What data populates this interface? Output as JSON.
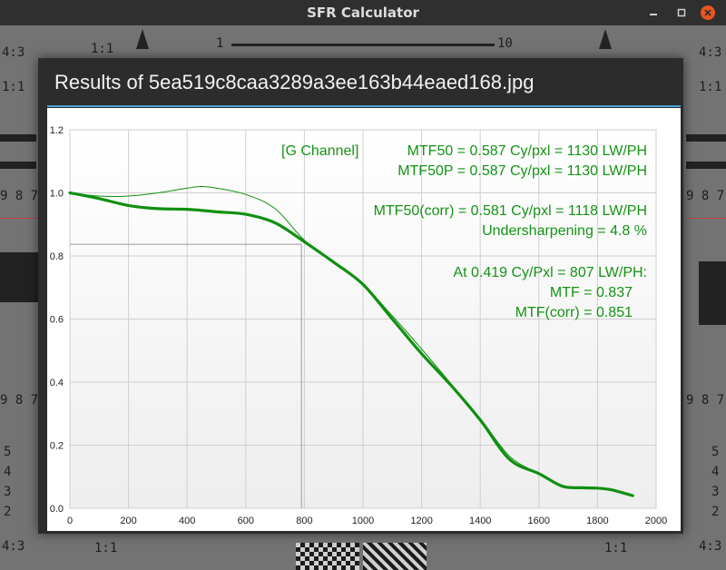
{
  "window": {
    "title": "SFR Calculator"
  },
  "dialog": {
    "title": "Results of 5ea519c8caa3289a3ee163b44eaed168.jpg"
  },
  "background_chart": {
    "top_ruler_start": "1",
    "top_ruler_end": "10",
    "left_labels": [
      "4:3",
      "1:1",
      "9 8 7",
      "9 8 7",
      "5",
      "4",
      "3",
      "2",
      "4:3"
    ],
    "right_labels": [
      "4:3",
      "1:1",
      "9 8 7",
      "9 8 7",
      "5",
      "4",
      "3",
      "2",
      "4:3"
    ],
    "bottom_labels": [
      "1:1",
      "1:1"
    ]
  },
  "annotations": {
    "channel": "[G Channel]",
    "mtf50": "MTF50 = 0.587 Cy/pxl = 1130 LW/PH",
    "mtf50p": "MTF50P = 0.587 Cy/pxl = 1130 LW/PH",
    "mtf50_corr": "MTF50(corr) = 0.581 Cy/pxl = 1118 LW/PH",
    "undersharpening": "Undersharpening = 4.8 %",
    "at_freq": "At 0.419 Cy/Pxl = 807 LW/PH:",
    "mtf_value": "MTF = 0.837",
    "mtf_corr_value": "MTF(corr) = 0.851"
  },
  "colors": {
    "curve": "#109010",
    "annotation_text": "#149314",
    "grid": "#cfcfcf",
    "marker": "#9a9a9a"
  },
  "chart_data": {
    "type": "line",
    "xlim": [
      0,
      2000
    ],
    "ylim": [
      0,
      1.2
    ],
    "x_ticks": [
      0,
      200,
      400,
      600,
      800,
      1000,
      1200,
      1400,
      1600,
      1800,
      2000
    ],
    "y_ticks": [
      0.0,
      0.2,
      0.4,
      0.6,
      0.8,
      1.0,
      1.2
    ],
    "x_tick_labels": [
      "0",
      "200",
      "400",
      "600",
      "800",
      "1000",
      "1200",
      "1400",
      "1600",
      "1800",
      "2000"
    ],
    "y_tick_labels": [
      "0.0",
      "0.2",
      "0.4",
      "0.6",
      "0.8",
      "1.0",
      "1.2"
    ],
    "grid": true,
    "series": [
      {
        "style": "thick",
        "x": [
          0,
          100,
          200,
          300,
          400,
          500,
          600,
          700,
          800,
          900,
          1000,
          1100,
          1200,
          1300,
          1400,
          1500,
          1600,
          1680,
          1750,
          1800,
          1850,
          1920
        ],
        "y": [
          1.0,
          0.982,
          0.96,
          0.95,
          0.948,
          0.94,
          0.932,
          0.905,
          0.845,
          0.78,
          0.71,
          0.6,
          0.49,
          0.39,
          0.28,
          0.155,
          0.11,
          0.07,
          0.065,
          0.064,
          0.058,
          0.04
        ]
      },
      {
        "style": "thin",
        "x": [
          0,
          100,
          200,
          300,
          400,
          450,
          500,
          600,
          700,
          800,
          900,
          1000,
          1100,
          1200,
          1300,
          1400,
          1500,
          1600,
          1680,
          1750,
          1800,
          1850,
          1920
        ],
        "y": [
          1.0,
          0.99,
          0.99,
          1.0,
          1.015,
          1.02,
          1.015,
          0.995,
          0.95,
          0.85,
          0.78,
          0.71,
          0.61,
          0.505,
          0.395,
          0.285,
          0.165,
          0.11,
          0.07,
          0.065,
          0.064,
          0.058,
          0.04
        ]
      }
    ],
    "marker": {
      "x": 790,
      "y": 0.837
    }
  }
}
